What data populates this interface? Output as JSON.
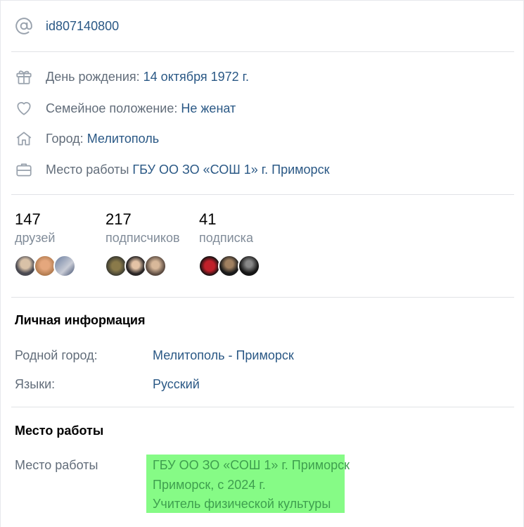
{
  "profile": {
    "screen_name": "id807140800",
    "birthday_label": "День рождения:",
    "birthday_value": "14 октября 1972 г.",
    "relation_label": "Семейное положение:",
    "relation_value": "Не женат",
    "city_label": "Город:",
    "city_value": "Мелитополь",
    "work_label": "Место работы",
    "work_value": "ГБУ ОО ЗО «СОШ 1» г. Приморск"
  },
  "counters": {
    "friends": {
      "count": "147",
      "label": "друзей"
    },
    "followers": {
      "count": "217",
      "label": "подписчиков"
    },
    "subscriptions": {
      "count": "41",
      "label": "подписка"
    }
  },
  "personal": {
    "title": "Личная информация",
    "hometown_label": "Родной город:",
    "hometown_value": "Мелитополь - Приморск",
    "languages_label": "Языки:",
    "languages_value": "Русский"
  },
  "career": {
    "title": "Место работы",
    "label": "Место работы",
    "line1": "ГБУ ОО ЗО «СОШ 1» г. Приморск",
    "line2": "Приморск, с 2024 г.",
    "line3": "Учитель физической культуры"
  },
  "colors": {
    "link": "#2a5885",
    "muted": "#626d7a",
    "highlight": "#86fb86"
  }
}
